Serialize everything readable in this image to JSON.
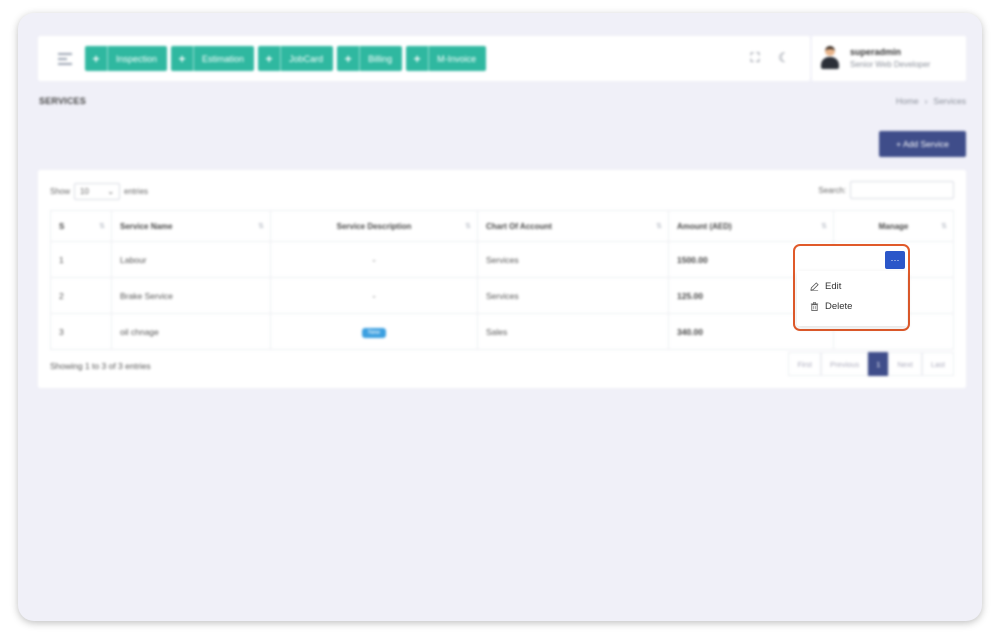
{
  "topbar": {
    "quick_actions": [
      "Inspection",
      "Estimation",
      "JobCard",
      "Billing",
      "M-Invoice"
    ]
  },
  "user": {
    "name": "superadmin",
    "role": "Senior Web Developer"
  },
  "page": {
    "title": "SERVICES",
    "breadcrumb": [
      "Home",
      "Services"
    ]
  },
  "add_button": "+ Add Service",
  "table_controls": {
    "show_label": "Show",
    "show_value": "10",
    "entries_label": "entries",
    "search_label": "Search:"
  },
  "table": {
    "headers": [
      "S",
      "Service Name",
      "Service Description",
      "Chart Of Account",
      "Amount (AED)",
      "Manage"
    ],
    "rows": [
      {
        "s": "1",
        "name": "Labour",
        "description": "-",
        "account": "Services",
        "amount": "1500.00"
      },
      {
        "s": "2",
        "name": "Brake Service",
        "description": "-",
        "account": "Services",
        "amount": "125.00"
      },
      {
        "s": "3",
        "name": "oil chnage",
        "description": "New",
        "account": "Sales",
        "amount": "340.00"
      }
    ]
  },
  "info": "Showing 1 to 3 of 3 entries",
  "pagination": [
    "First",
    "Previous",
    "1",
    "Next",
    "Last"
  ],
  "dropdown": {
    "trigger": "···",
    "items": [
      "Edit",
      "Delete"
    ]
  },
  "colors": {
    "accent": "#2fb8a0",
    "primary": "#3f4d8a",
    "kebab": "#2b57c9",
    "highlight": "#e05a2a"
  }
}
